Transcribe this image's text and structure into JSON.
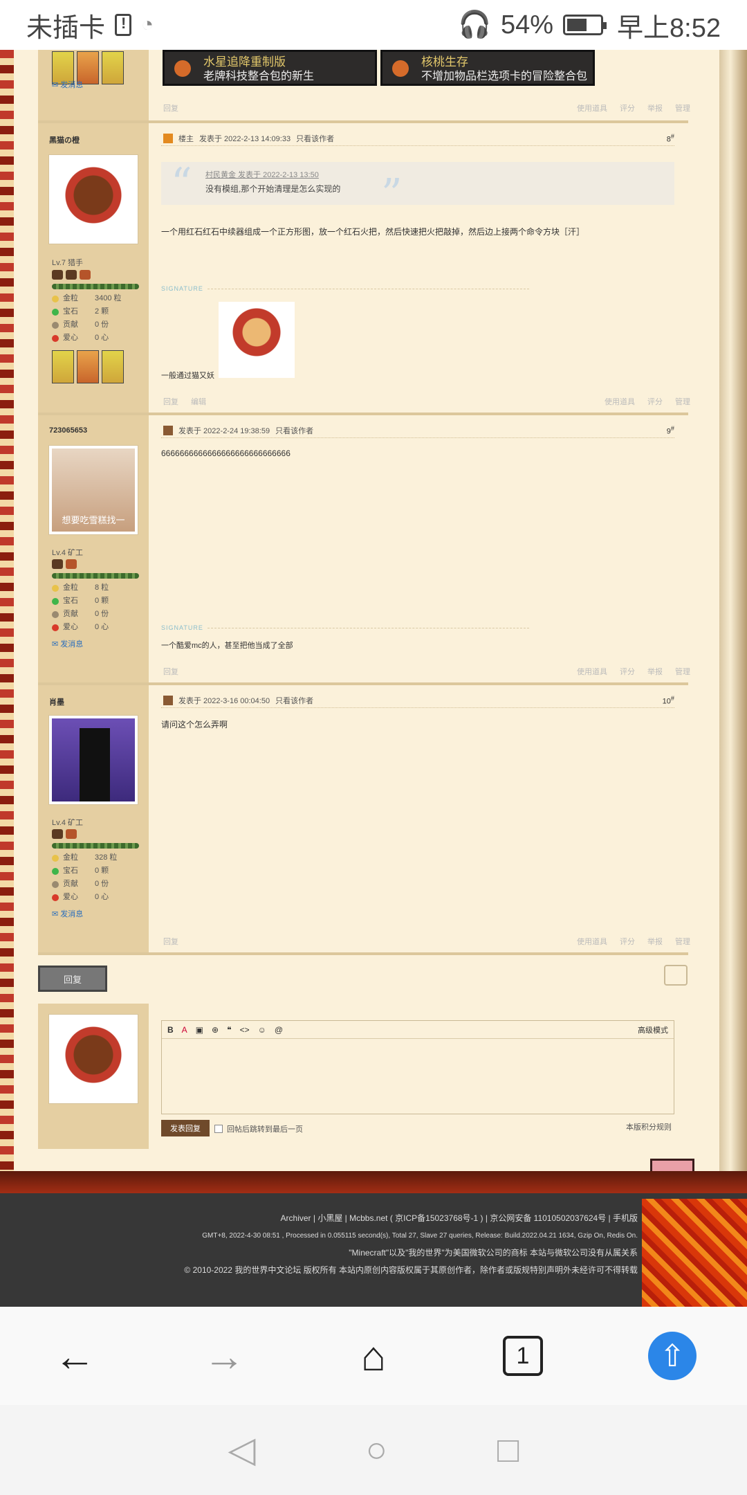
{
  "status_bar": {
    "carrier": "未插卡",
    "battery": "54%",
    "time": "早上8:52"
  },
  "top_cards": [
    {
      "title": "水星追降重制版",
      "desc": "老牌科技整合包的新生"
    },
    {
      "title": "核桃生存",
      "desc": "不增加物品栏选项卡的冒险整合包"
    }
  ],
  "first_footer": {
    "reply": "回复",
    "tools": "使用道具",
    "rate": "评分",
    "report": "举报",
    "manage": "管理"
  },
  "top_msg": "发消息",
  "posts": [
    {
      "user": "黑猫の橙",
      "level": "Lv.7 猎手",
      "stats": {
        "gold": "3400 粒",
        "gem": "2 颗",
        "contrib": "0 份",
        "love": "0 心"
      },
      "badge": "楼主",
      "time": "发表于 2022-2-13 14:09:33",
      "only": "只看该作者",
      "floor": "8",
      "quote_src": "村民黄金 发表于 2022-2-13 13:50",
      "quote_text": "没有模组,那个开始清理是怎么实现的",
      "content": "一个用红石红石中续器组成一个正方形图，放一个红石火把，然后快速把火把敲掉，然后边上接两个命令方块［汗］",
      "signature": "一般通过猫又妖",
      "footer": {
        "reply": "回复",
        "edit": "编辑",
        "tools": "使用道具",
        "rate": "评分",
        "manage": "管理"
      }
    },
    {
      "user": "723065653",
      "level": "Lv.4 矿工",
      "avatar_text": "想要吃雪糕找一",
      "stats": {
        "gold": "8 粒",
        "gem": "0 颗",
        "contrib": "0 份",
        "love": "0 心"
      },
      "msg": "发消息",
      "time": "发表于 2022-2-24 19:38:59",
      "only": "只看该作者",
      "floor": "9",
      "content": "6666666666666666666666666666",
      "signature": "一个酷爱mc的人，甚至把他当成了全部",
      "footer": {
        "reply": "回复",
        "tools": "使用道具",
        "rate": "评分",
        "report": "举报",
        "manage": "管理"
      }
    },
    {
      "user": "肖墨",
      "level": "Lv.4 矿工",
      "stats": {
        "gold": "328 粒",
        "gem": "0 颗",
        "contrib": "0 份",
        "love": "0 心"
      },
      "msg": "发消息",
      "time": "发表于 2022-3-16 00:04:50",
      "only": "只看该作者",
      "floor": "10",
      "content": "请问这个怎么弄啊",
      "footer": {
        "reply": "回复",
        "tools": "使用道具",
        "rate": "评分",
        "report": "举报",
        "manage": "管理"
      }
    }
  ],
  "stat_labels": {
    "gold": "金粒",
    "gem": "宝石",
    "contrib": "贡献",
    "love": "爱心"
  },
  "reply_section": {
    "reply_button": "回复",
    "advanced": "高级模式",
    "submit": "发表回复",
    "jump": "回帖后跳转到最后一页",
    "rules": "本版积分规则"
  },
  "footer": {
    "line1": "Archiver | 小黑屋 | Mcbbs.net ( 京ICP备15023768号-1 ) | 京公网安备 11010502037624号 | 手机版",
    "line2": "GMT+8, 2022-4-30 08:51 , Processed in 0.055115 second(s), Total 27, Slave 27 queries, Release: Build.2022.04.21 1634, Gzip On, Redis On.",
    "line3": "\"Minecraft\"以及\"我的世界\"为美国微软公司的商标 本站与微软公司没有从属关系",
    "line4": "© 2010-2022 我的世界中文论坛 版权所有 本站内原创内容版权属于其原创作者，除作者或版规特别声明外未经许可不得转载"
  },
  "browser": {
    "tab_count": "1"
  }
}
